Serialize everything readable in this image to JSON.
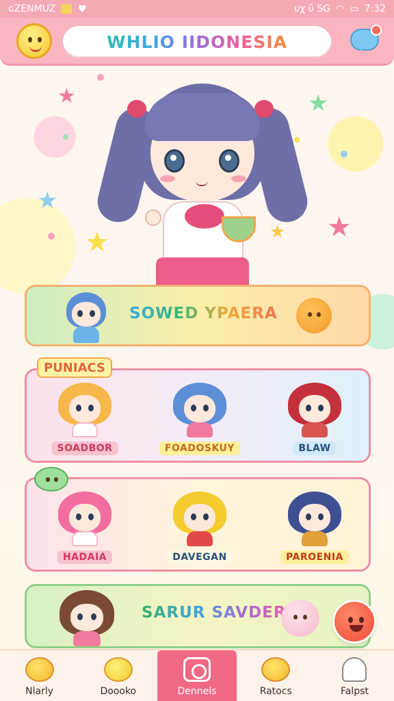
{
  "status_bar": {
    "left_text": "ɢZENMUZ",
    "right_text": "υχ ῡ SG",
    "time": "7:32"
  },
  "header": {
    "title": "WHLIO IIDONESIA",
    "avatar_icon": "smiley-face-icon",
    "chat_icon": "chat-bubble-icon"
  },
  "banner_top": {
    "title": "SOWED YPAERA",
    "icon": "orange-blob-icon"
  },
  "section_tag": "PUNIACS",
  "character_row_1": [
    {
      "name": "SOADBOR",
      "chip_color": "#f7c3cf",
      "text_color": "#d2385f",
      "hair": "#f6b84a"
    },
    {
      "name": "FOADOSKUY",
      "chip_color": "#fff09a",
      "text_color": "#c46a1c",
      "hair": "#5d8fd6"
    },
    {
      "name": "BLAW",
      "chip_color": "#cfe9fa",
      "text_color": "#2a4f7c",
      "hair": "#c5303d"
    }
  ],
  "character_row_2": [
    {
      "name": "HADAIA",
      "chip_color": "#f7c3cf",
      "text_color": "#d2385f",
      "hair": "#f26ea0"
    },
    {
      "name": "DAVEGAN",
      "chip_color": "#fff8e0",
      "text_color": "#2a4f7c",
      "hair": "#f4cc2e"
    },
    {
      "name": "PAROENIA",
      "chip_color": "#fff09a",
      "text_color": "#c43a1c",
      "hair": "#3f4f94"
    }
  ],
  "banner_bottom": {
    "title": "SARUR SAVDERY",
    "icon": "pink-blob-icon",
    "fab_icon": "red-smiley-fab-icon"
  },
  "bottom_nav": [
    {
      "label": "Nlarly",
      "icon": "yellow-mascot-icon",
      "active": false
    },
    {
      "label": "Doooko",
      "icon": "chick-icon",
      "active": false
    },
    {
      "label": "Dennels",
      "icon": "camera-icon",
      "active": true
    },
    {
      "label": "Ratocs",
      "icon": "yellow-face-icon",
      "active": false
    },
    {
      "label": "Falpst",
      "icon": "ghost-icon",
      "active": false
    }
  ],
  "colors": {
    "header_bg": "#f9b6c1",
    "nav_active": "#f06a86",
    "status_bar": "#f4a9b3"
  }
}
